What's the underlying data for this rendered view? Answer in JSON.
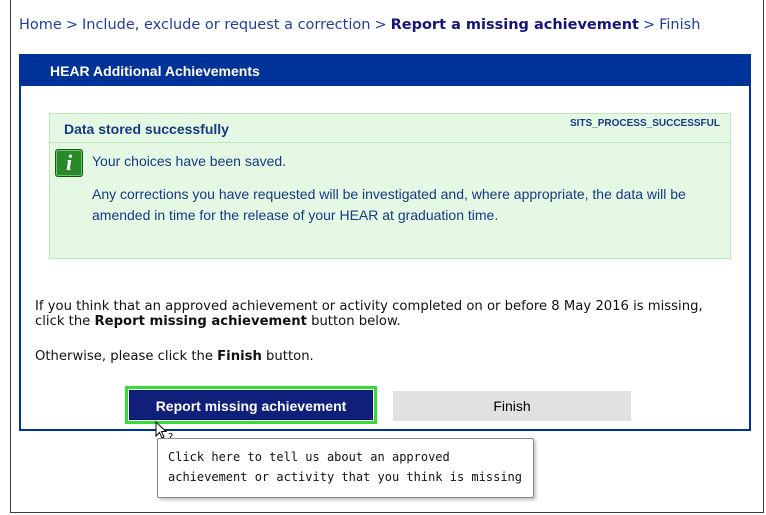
{
  "breadcrumb": {
    "home": "Home",
    "sep": ">",
    "step2": "Include, exclude or request a correction",
    "current": "Report a missing achievement",
    "step4": "Finish"
  },
  "panel": {
    "title": "HEAR Additional Achievements"
  },
  "message": {
    "title": "Data stored successfully",
    "code": "SITS_PROCESS_SUCCESSFUL",
    "icon": "info-icon",
    "color": "#e5f8e3",
    "line1": "Your choices have been saved.",
    "line2": "Any corrections you have requested will be investigated and, where appropriate, the data will be amended in time for the release of your HEAR at graduation time."
  },
  "body": {
    "p1_a": "If you think that an approved achievement or activity completed on or before 8 May 2016 is missing, click the ",
    "p1_b": "Report missing achievement",
    "p1_c": " button below.",
    "p2_a": "Otherwise, please click the ",
    "p2_b": "Finish",
    "p2_c": " button."
  },
  "buttons": {
    "report": "Report missing achievement",
    "finish": "Finish",
    "accent": "#0f1f7a",
    "focus": "#33dd33"
  },
  "tooltip": {
    "text": "Click here to tell us about an approved achievement or activity that you think is missing"
  }
}
